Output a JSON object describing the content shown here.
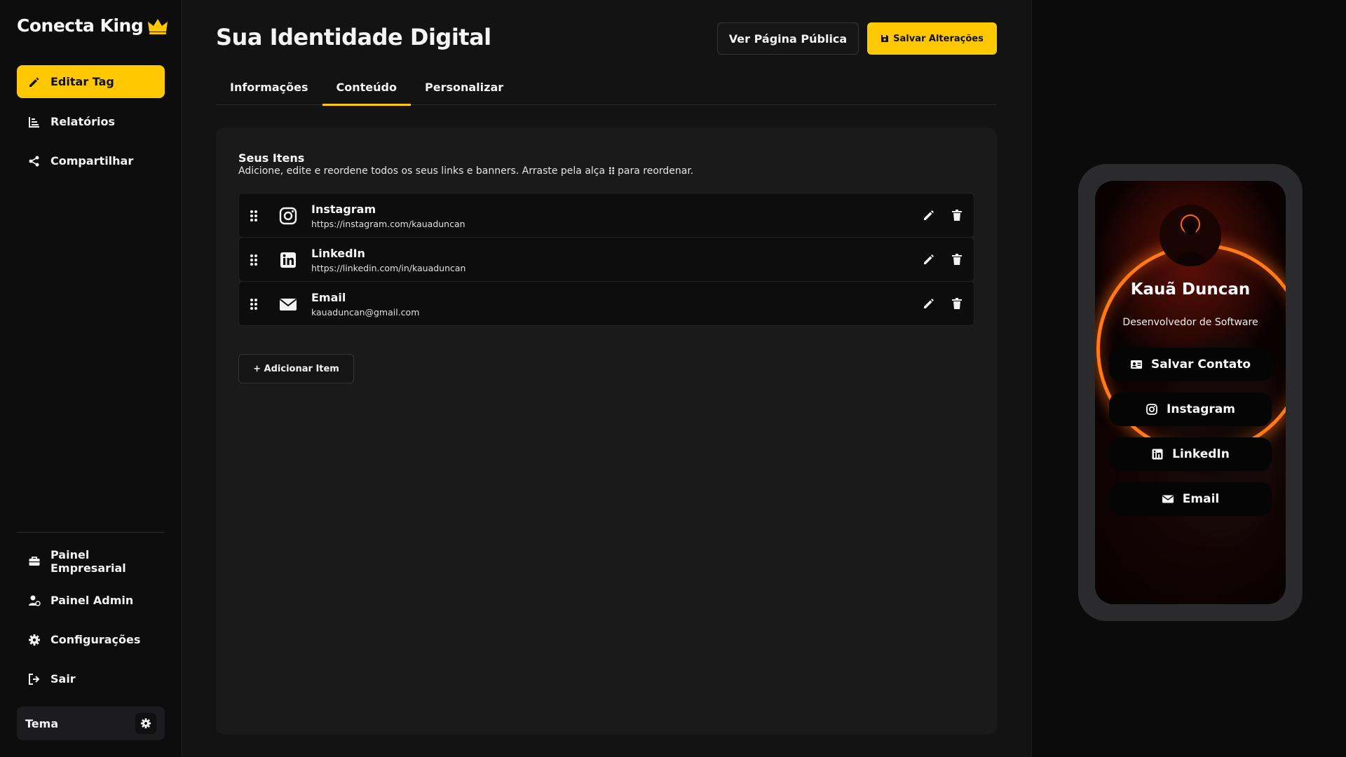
{
  "brand": {
    "name": "Conecta King",
    "icon": "crown-icon",
    "accent": "#ffc800"
  },
  "sidebar": {
    "top_items": [
      {
        "label": "Editar Tag",
        "icon": "pencil-icon",
        "active": true
      },
      {
        "label": "Relatórios",
        "icon": "bar-chart-icon"
      },
      {
        "label": "Compartilhar",
        "icon": "share-icon"
      }
    ],
    "bottom_items": [
      {
        "label": "Painel Empresarial",
        "icon": "briefcase-icon"
      },
      {
        "label": "Painel Admin",
        "icon": "user-gear-icon"
      },
      {
        "label": "Configurações",
        "icon": "gear-icon"
      },
      {
        "label": "Sair",
        "icon": "logout-icon"
      }
    ],
    "theme": {
      "label": "Tema",
      "icon": "gear-icon"
    }
  },
  "header": {
    "title": "Sua Identidade Digital",
    "view_public_label": "Ver Página Pública",
    "save_label": "Salvar Alterações"
  },
  "tabs": [
    {
      "label": "Informações",
      "active": false
    },
    {
      "label": "Conteúdo",
      "active": true
    },
    {
      "label": "Personalizar",
      "active": false
    }
  ],
  "content": {
    "title": "Seus Itens",
    "description_before": "Adicione, edite e reordene todos os seus links e banners. Arraste pela alça",
    "description_after": "para reordenar.",
    "items": [
      {
        "label": "Instagram",
        "value": "https://instagram.com/kauaduncan",
        "icon": "instagram-icon"
      },
      {
        "label": "LinkedIn",
        "value": "https://linkedin.com/in/kauaduncan",
        "icon": "linkedin-icon"
      },
      {
        "label": "Email",
        "value": "kauaduncan@gmail.com",
        "icon": "envelope-icon"
      }
    ],
    "add_label": "+ Adicionar Item"
  },
  "preview": {
    "name": "Kauã Duncan",
    "role": "Desenvolvedor de Software",
    "ring_color": "#ff7a18",
    "buttons": [
      {
        "label": "Salvar Contato",
        "icon": "contact-card-icon"
      },
      {
        "label": "Instagram",
        "icon": "instagram-icon"
      },
      {
        "label": "LinkedIn",
        "icon": "linkedin-icon"
      },
      {
        "label": "Email",
        "icon": "envelope-icon"
      }
    ]
  }
}
